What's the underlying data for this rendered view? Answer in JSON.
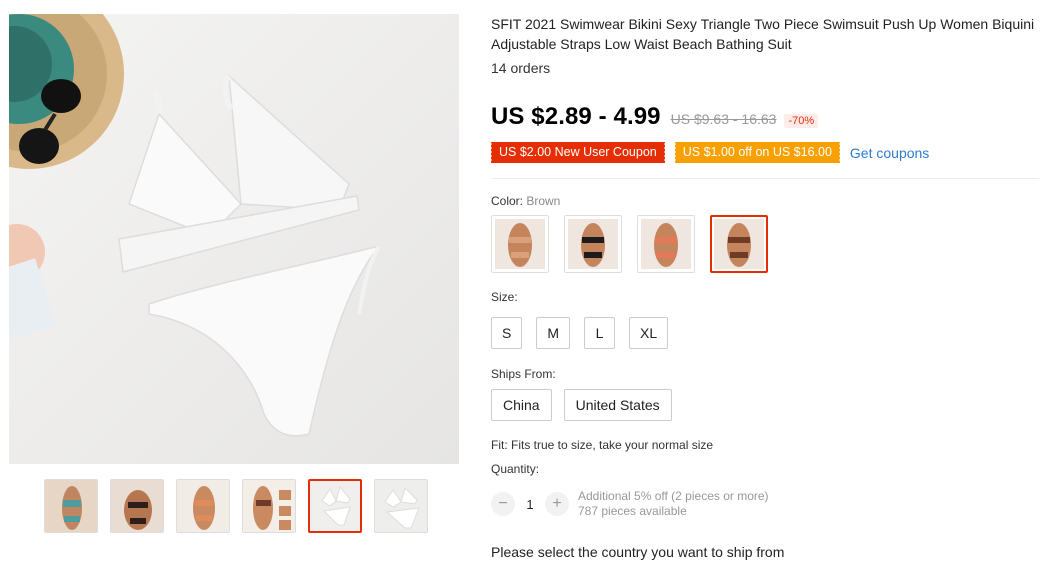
{
  "product": {
    "title": "SFIT 2021 Swimwear Bikini Sexy Triangle Two Piece Swimsuit Push Up Women Biquini Adjustable Straps Low Waist Beach Bathing Suit",
    "orders": "14 orders",
    "price": "US $2.89 - 4.99",
    "old_price": "US $9.63 - 16.63",
    "discount": "-70%"
  },
  "coupons": {
    "new_user": "US $2.00 New User Coupon",
    "off": "US $1.00 off on US $16.00",
    "get_link": "Get coupons"
  },
  "color": {
    "label": "Color: ",
    "selected": "Brown"
  },
  "size": {
    "label": "Size:",
    "options": [
      "S",
      "M",
      "L",
      "XL"
    ]
  },
  "ships_from": {
    "label": "Ships From:",
    "options": [
      "China",
      "United States"
    ]
  },
  "fit": "Fit: Fits true to size, take your normal size",
  "quantity": {
    "label": "Quantity:",
    "value": "1",
    "minus": "−",
    "plus": "+",
    "note_line1": "Additional 5% off (2 pieces or more)",
    "note_line2": "787 pieces available"
  },
  "ship_country": "Please select the country you want to ship from",
  "colors_ui": {
    "accent": "#e62e04",
    "coupon_orange": "#f7a000",
    "link_blue": "#2e7ccf"
  }
}
